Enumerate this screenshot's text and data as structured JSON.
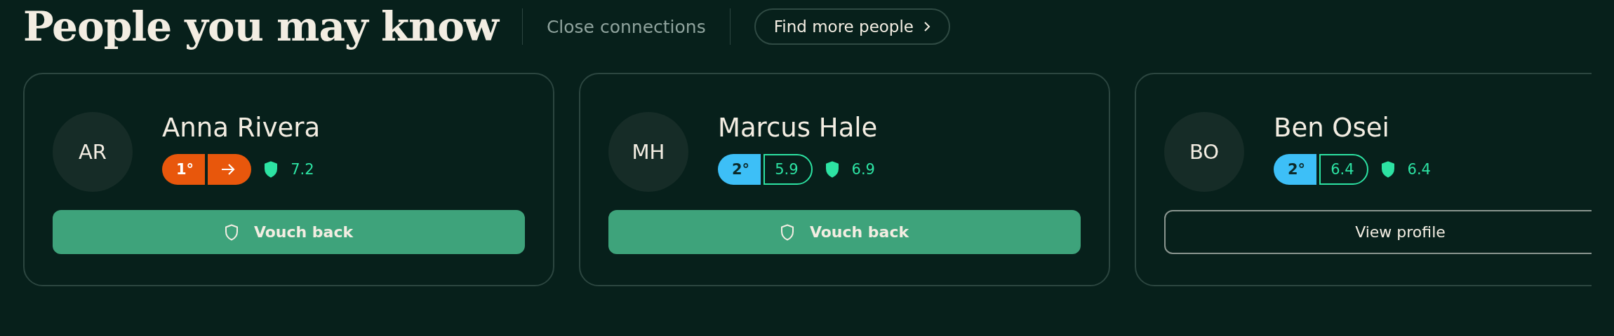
{
  "header": {
    "title": "People you may know",
    "subtitle": "Close connections",
    "button": "Find more people"
  },
  "people": [
    {
      "initials": "AR",
      "name": "Anna Rivera",
      "connection": {
        "kind": "direct",
        "degree": "1°"
      },
      "trust": "7.2",
      "action": {
        "kind": "primary",
        "label": "Vouch back"
      }
    },
    {
      "initials": "MH",
      "name": "Marcus Hale",
      "connection": {
        "kind": "mutual",
        "degree": "2°",
        "score": "5.9"
      },
      "trust": "6.9",
      "action": {
        "kind": "primary",
        "label": "Vouch back"
      }
    },
    {
      "initials": "BO",
      "name": "Ben Osei",
      "connection": {
        "kind": "mutual",
        "degree": "2°",
        "score": "6.4"
      },
      "trust": "6.4",
      "action": {
        "kind": "outline",
        "label": "View profile"
      }
    }
  ]
}
